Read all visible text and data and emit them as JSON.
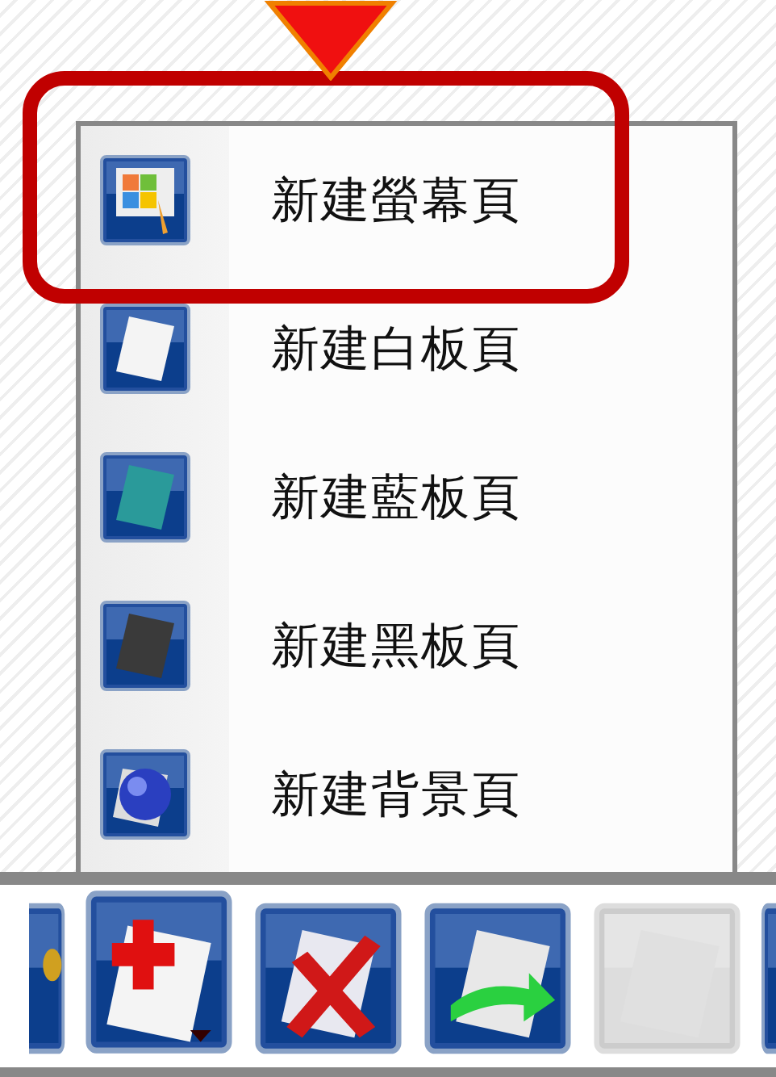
{
  "menu": {
    "items": [
      {
        "kind": "screen",
        "label": "新建螢幕頁",
        "highlighted": true
      },
      {
        "kind": "white",
        "label": "新建白板頁",
        "highlighted": false
      },
      {
        "kind": "blue",
        "label": "新建藍板頁",
        "highlighted": false
      },
      {
        "kind": "black",
        "label": "新建黑板頁",
        "highlighted": false
      },
      {
        "kind": "background",
        "label": "新建背景頁",
        "highlighted": false
      }
    ]
  },
  "toolbar": {
    "buttons": [
      {
        "kind": "partial",
        "disabled": false,
        "open": false
      },
      {
        "kind": "add",
        "disabled": false,
        "open": true
      },
      {
        "kind": "delete",
        "disabled": false,
        "open": false
      },
      {
        "kind": "restore",
        "disabled": false,
        "open": false
      },
      {
        "kind": "blank",
        "disabled": true,
        "open": false
      },
      {
        "kind": "edge",
        "disabled": false,
        "open": false
      }
    ]
  }
}
